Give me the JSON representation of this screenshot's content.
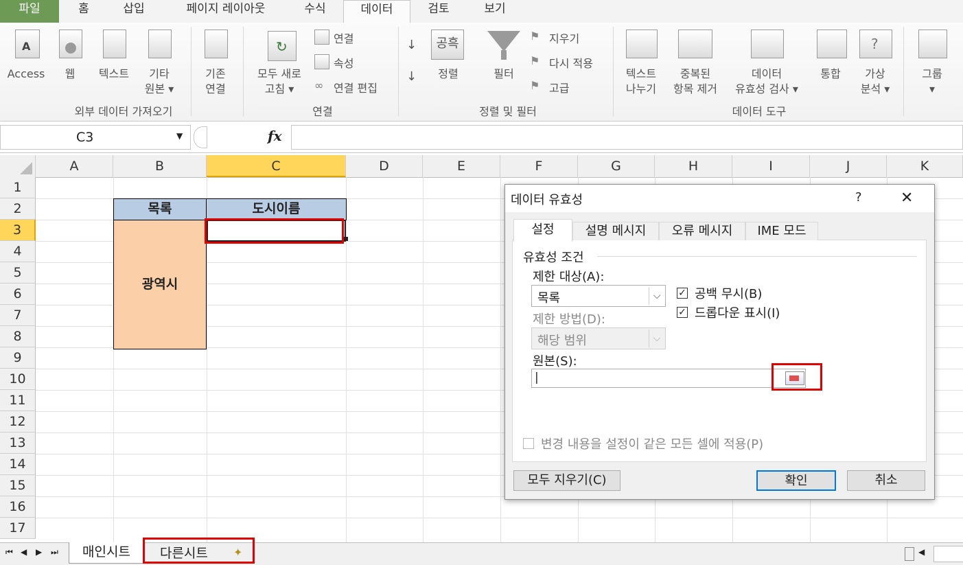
{
  "ribbon_tabs": [
    "파일",
    "홈",
    "삽입",
    "페이지 레이아웃",
    "수식",
    "데이터",
    "검토",
    "보기"
  ],
  "ribbon": {
    "ext_data": {
      "access": "Access",
      "web": "웹",
      "text": "텍스트",
      "other1": "기타",
      "other2": "원본 ▾",
      "group": "외부 데이터 가져오기"
    },
    "existing": {
      "line1": "기존",
      "line2": "연결"
    },
    "connections": {
      "refresh1": "모두 새로",
      "refresh2": "고침 ▾",
      "conn": "연결",
      "props": "속성",
      "edit": "연결 편집",
      "group": "연결"
    },
    "sort": {
      "asc": "↓",
      "sort_label": "정렬",
      "filter": "필터",
      "clear": "지우기",
      "reapply": "다시 적용",
      "advanced": "고급",
      "group": "정렬 및 필터",
      "az1": "공",
      "az2": "흑"
    },
    "tools": {
      "split1": "텍스트",
      "split2": "나누기",
      "dup1": "중복된",
      "dup2": "항목 제거",
      "val1": "데이터",
      "val2": "유효성 검사 ▾",
      "cons": "통합",
      "whatif1": "가상",
      "whatif2": "분석 ▾",
      "group": "데이터 도구"
    },
    "outline": {
      "group_btn": "그룹",
      "group_arrow": "▾"
    }
  },
  "namebox": "C3",
  "fx": "fx",
  "columns": [
    "A",
    "B",
    "C",
    "D",
    "E",
    "F",
    "G",
    "H",
    "I",
    "J",
    "K"
  ],
  "rows": [
    "1",
    "2",
    "3",
    "4",
    "5",
    "6",
    "7",
    "8",
    "9",
    "10",
    "11",
    "12",
    "13",
    "14",
    "15",
    "16",
    "17"
  ],
  "cells": {
    "b2": "목록",
    "c2": "도시이름",
    "b3": "광역시"
  },
  "dialog": {
    "title": "데이터 유효성",
    "help": "?",
    "close": "✕",
    "tabs": [
      "설정",
      "설명 메시지",
      "오류 메시지",
      "IME 모드"
    ],
    "criteria_label": "유효성 조건",
    "allow_label": "제한 대상(A):",
    "allow_value": "목록",
    "data_label": "제한 방법(D):",
    "data_value": "해당 범위",
    "ignore_blank": "공백 무시(B)",
    "dropdown": "드롭다운 표시(I)",
    "source_label": "원본(S):",
    "source_value": "|",
    "apply_all": "변경 내용을 설정이 같은 모든 셀에 적용(P)",
    "clear_all": "모두 지우기(C)",
    "ok": "확인",
    "cancel": "취소"
  },
  "sheets": [
    "매인시트",
    "다른시트"
  ],
  "colors": {
    "header_blue": "#b8cce4",
    "peach": "#fbd0a9",
    "red": "#e00000",
    "file_green": "#6d9a55"
  }
}
